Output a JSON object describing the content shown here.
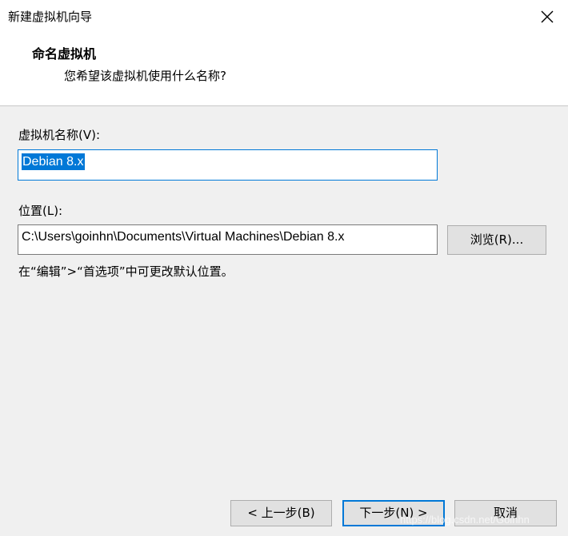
{
  "window": {
    "title": "新建虚拟机向导",
    "close_icon": "close-icon"
  },
  "header": {
    "heading": "命名虚拟机",
    "subheading": "您希望该虚拟机使用什么名称?"
  },
  "form": {
    "name_label": "虚拟机名称(V):",
    "name_value": "Debian 8.x",
    "location_label": "位置(L):",
    "location_value": "C:\\Users\\goinhn\\Documents\\Virtual Machines\\Debian 8.x",
    "browse_label": "浏览(R)...",
    "hint": "在“编辑”>“首选项”中可更改默认位置。"
  },
  "footer": {
    "back_label": "< 上一步(B)",
    "next_label": "下一步(N) >",
    "cancel_label": "取消"
  },
  "watermark": "https://blog.csdn.net/Goinhn",
  "colors": {
    "accent": "#0078d7",
    "background": "#f0f0f0",
    "header_background": "#ffffff"
  }
}
